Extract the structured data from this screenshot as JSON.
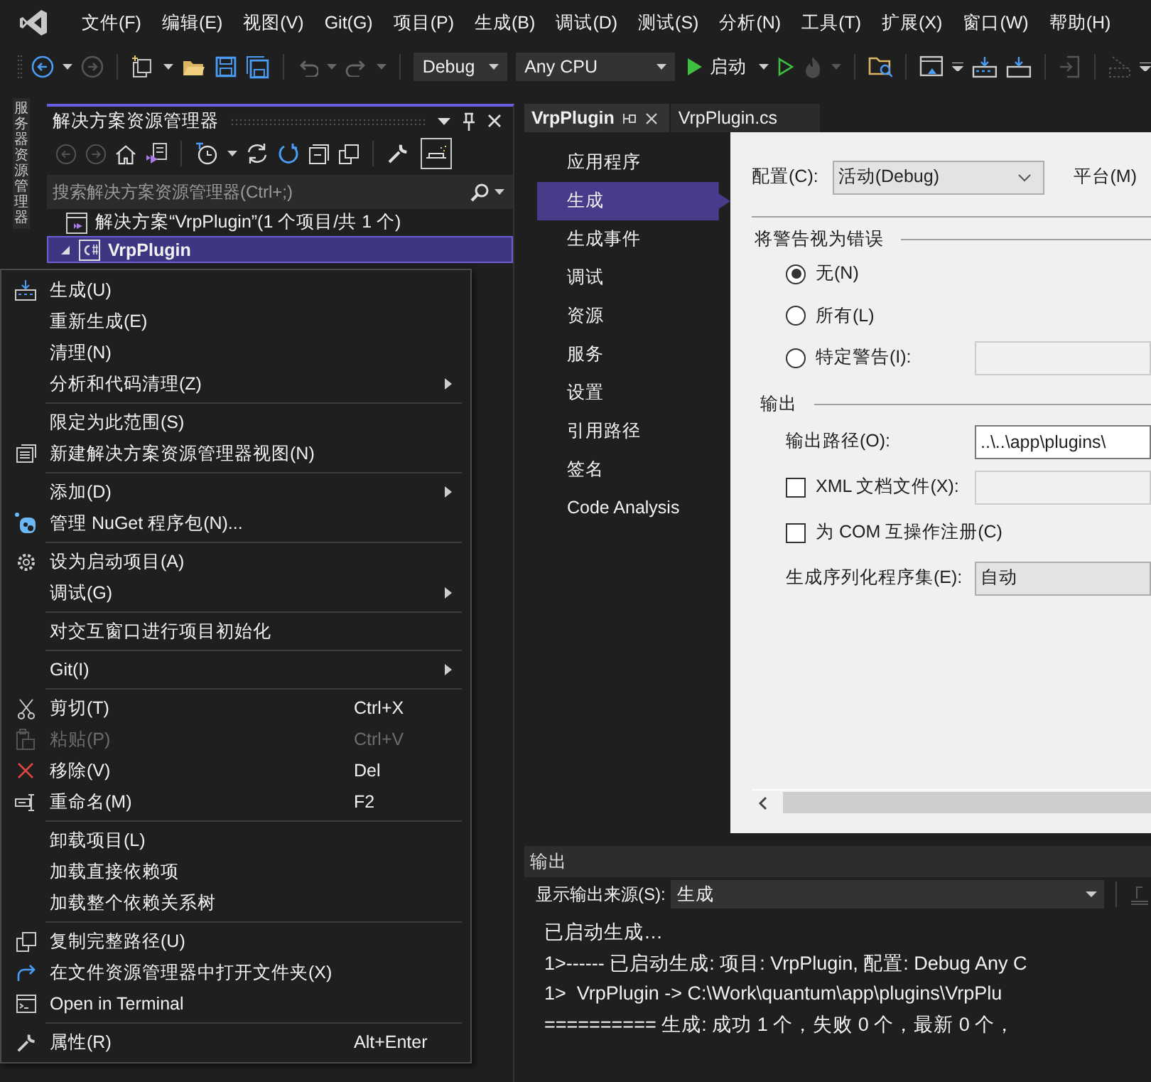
{
  "menubar": {
    "items": [
      "文件(F)",
      "编辑(E)",
      "视图(V)",
      "Git(G)",
      "项目(P)",
      "生成(B)",
      "调试(D)",
      "测试(S)",
      "分析(N)",
      "工具(T)",
      "扩展(X)",
      "窗口(W)",
      "帮助(H)"
    ]
  },
  "toolbar": {
    "configuration": "Debug",
    "platform": "Any CPU",
    "start_label": "启动"
  },
  "side_strip": {
    "label": "服务器资源管理器"
  },
  "solution_explorer": {
    "title": "解决方案资源管理器",
    "search": {
      "placeholder": "搜索解决方案资源管理器(Ctrl+;)"
    },
    "tree": [
      {
        "label": "解决方案“VrpPlugin”(1 个项目/共 1 个)",
        "selected": false,
        "children": [
          {
            "label": "VrpPlugin",
            "selected": true,
            "expanded": true
          }
        ]
      }
    ]
  },
  "context_menu": {
    "items": [
      {
        "kind": "build",
        "label": "生成(U)",
        "submenu": false,
        "disabled": false
      },
      {
        "kind": "plain",
        "label": "重新生成(E)",
        "submenu": false,
        "disabled": false
      },
      {
        "kind": "plain",
        "label": "清理(N)",
        "submenu": false,
        "disabled": false
      },
      {
        "kind": "plain",
        "label": "分析和代码清理(Z)",
        "submenu": true,
        "disabled": false
      },
      {
        "kind": "separator"
      },
      {
        "kind": "plain",
        "label": "限定为此范围(S)",
        "submenu": false,
        "disabled": false
      },
      {
        "kind": "view",
        "label": "新建解决方案资源管理器视图(N)",
        "submenu": false,
        "disabled": false
      },
      {
        "kind": "separator"
      },
      {
        "kind": "plain",
        "label": "添加(D)",
        "submenu": true,
        "disabled": false
      },
      {
        "kind": "nuget",
        "label": "管理 NuGet 程序包(N)...",
        "submenu": false,
        "disabled": false
      },
      {
        "kind": "separator"
      },
      {
        "kind": "gear",
        "label": "设为启动项目(A)",
        "submenu": false,
        "disabled": false
      },
      {
        "kind": "plain",
        "label": "调试(G)",
        "submenu": true,
        "disabled": false
      },
      {
        "kind": "separator"
      },
      {
        "kind": "plain",
        "label": "对交互窗口进行项目初始化",
        "submenu": false,
        "disabled": false
      },
      {
        "kind": "separator"
      },
      {
        "kind": "plain",
        "label": "Git(I)",
        "submenu": true,
        "disabled": false
      },
      {
        "kind": "separator"
      },
      {
        "kind": "cut",
        "label": "剪切(T)",
        "shortcut": "Ctrl+X",
        "submenu": false,
        "disabled": false
      },
      {
        "kind": "paste",
        "label": "粘贴(P)",
        "shortcut": "Ctrl+V",
        "submenu": false,
        "disabled": true
      },
      {
        "kind": "remove",
        "label": "移除(V)",
        "shortcut": "Del",
        "submenu": false,
        "disabled": false
      },
      {
        "kind": "rename",
        "label": "重命名(M)",
        "shortcut": "F2",
        "submenu": false,
        "disabled": false
      },
      {
        "kind": "separator"
      },
      {
        "kind": "plain",
        "label": "卸载项目(L)",
        "submenu": false,
        "disabled": false
      },
      {
        "kind": "plain",
        "label": "加载直接依赖项",
        "submenu": false,
        "disabled": false
      },
      {
        "kind": "plain",
        "label": "加载整个依赖关系树",
        "submenu": false,
        "disabled": false
      },
      {
        "kind": "separator"
      },
      {
        "kind": "copy",
        "label": "复制完整路径(U)",
        "submenu": false,
        "disabled": false
      },
      {
        "kind": "folder",
        "label": "在文件资源管理器中打开文件夹(X)",
        "submenu": false,
        "disabled": false
      },
      {
        "kind": "terminal",
        "label": "Open in Terminal",
        "submenu": false,
        "disabled": false
      },
      {
        "kind": "separator"
      },
      {
        "kind": "wrench",
        "label": "属性(R)",
        "shortcut": "Alt+Enter",
        "submenu": false,
        "disabled": false
      }
    ]
  },
  "document_tabs": [
    {
      "label": "VrpPlugin",
      "selected": true
    },
    {
      "label": "VrpPlugin.cs",
      "selected": false
    }
  ],
  "property_nav": {
    "items": [
      {
        "label": "应用程序",
        "selected": false
      },
      {
        "label": "生成",
        "selected": true
      },
      {
        "label": "生成事件",
        "selected": false
      },
      {
        "label": "调试",
        "selected": false
      },
      {
        "label": "资源",
        "selected": false
      },
      {
        "label": "服务",
        "selected": false
      },
      {
        "label": "设置",
        "selected": false
      },
      {
        "label": "引用路径",
        "selected": false
      },
      {
        "label": "签名",
        "selected": false
      },
      {
        "label": "Code Analysis",
        "selected": false
      }
    ]
  },
  "build_page": {
    "configuration": {
      "label": "配置(C):",
      "value": "活动(Debug)"
    },
    "platform": {
      "label": "平台(M)"
    },
    "warnings": {
      "title": "将警告视为错误",
      "options": [
        {
          "kind": "plain",
          "label": "无(N)",
          "selected": true
        },
        {
          "kind": "plain",
          "label": "所有(L)",
          "selected": false
        },
        {
          "kind": "field",
          "label": "特定警告(I):",
          "selected": false
        }
      ]
    },
    "output": {
      "title": "输出",
      "path": {
        "label": "输出路径(O):",
        "value": "..\\..\\app\\plugins\\"
      },
      "xml_doc": {
        "label": "XML 文档文件(X):",
        "checked": false
      },
      "com_interop": {
        "label": "为 COM 互操作注册(C)",
        "checked": false
      },
      "serialization": {
        "label": "生成序列化程序集(E):",
        "value": "自动"
      }
    }
  },
  "output_panel": {
    "title": "输出",
    "source_label": "显示输出来源(S):",
    "source_value": "生成",
    "lines": [
      "已启动生成…",
      "1>------ 已启动生成: 项目: VrpPlugin, 配置: Debug Any C",
      "1>  VrpPlugin -> C:\\Work\\quantum\\app\\plugins\\VrpPlu",
      "========== 生成: 成功 1 个，失败 0 个，最新 0 个，"
    ]
  }
}
